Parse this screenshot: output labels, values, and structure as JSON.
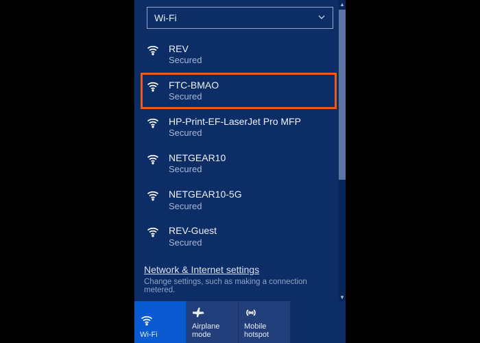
{
  "selector": {
    "label": "Wi-Fi"
  },
  "networks": [
    {
      "ssid": "REV",
      "security": "Secured",
      "highlight": false
    },
    {
      "ssid": "FTC-BMAO",
      "security": "Secured",
      "highlight": true
    },
    {
      "ssid": "HP-Print-EF-LaserJet Pro MFP",
      "security": "Secured",
      "highlight": false
    },
    {
      "ssid": "NETGEAR10",
      "security": "Secured",
      "highlight": false
    },
    {
      "ssid": "NETGEAR10-5G",
      "security": "Secured",
      "highlight": false
    },
    {
      "ssid": "REV-Guest",
      "security": "Secured",
      "highlight": false
    }
  ],
  "footer": {
    "link": "Network & Internet settings",
    "sub": "Change settings, such as making a connection metered."
  },
  "tiles": {
    "wifi": {
      "label": "Wi-Fi",
      "active": true
    },
    "airplane": {
      "label": "Airplane mode",
      "active": false
    },
    "hotspot": {
      "label": "Mobile\nhotspot",
      "active": false
    }
  }
}
